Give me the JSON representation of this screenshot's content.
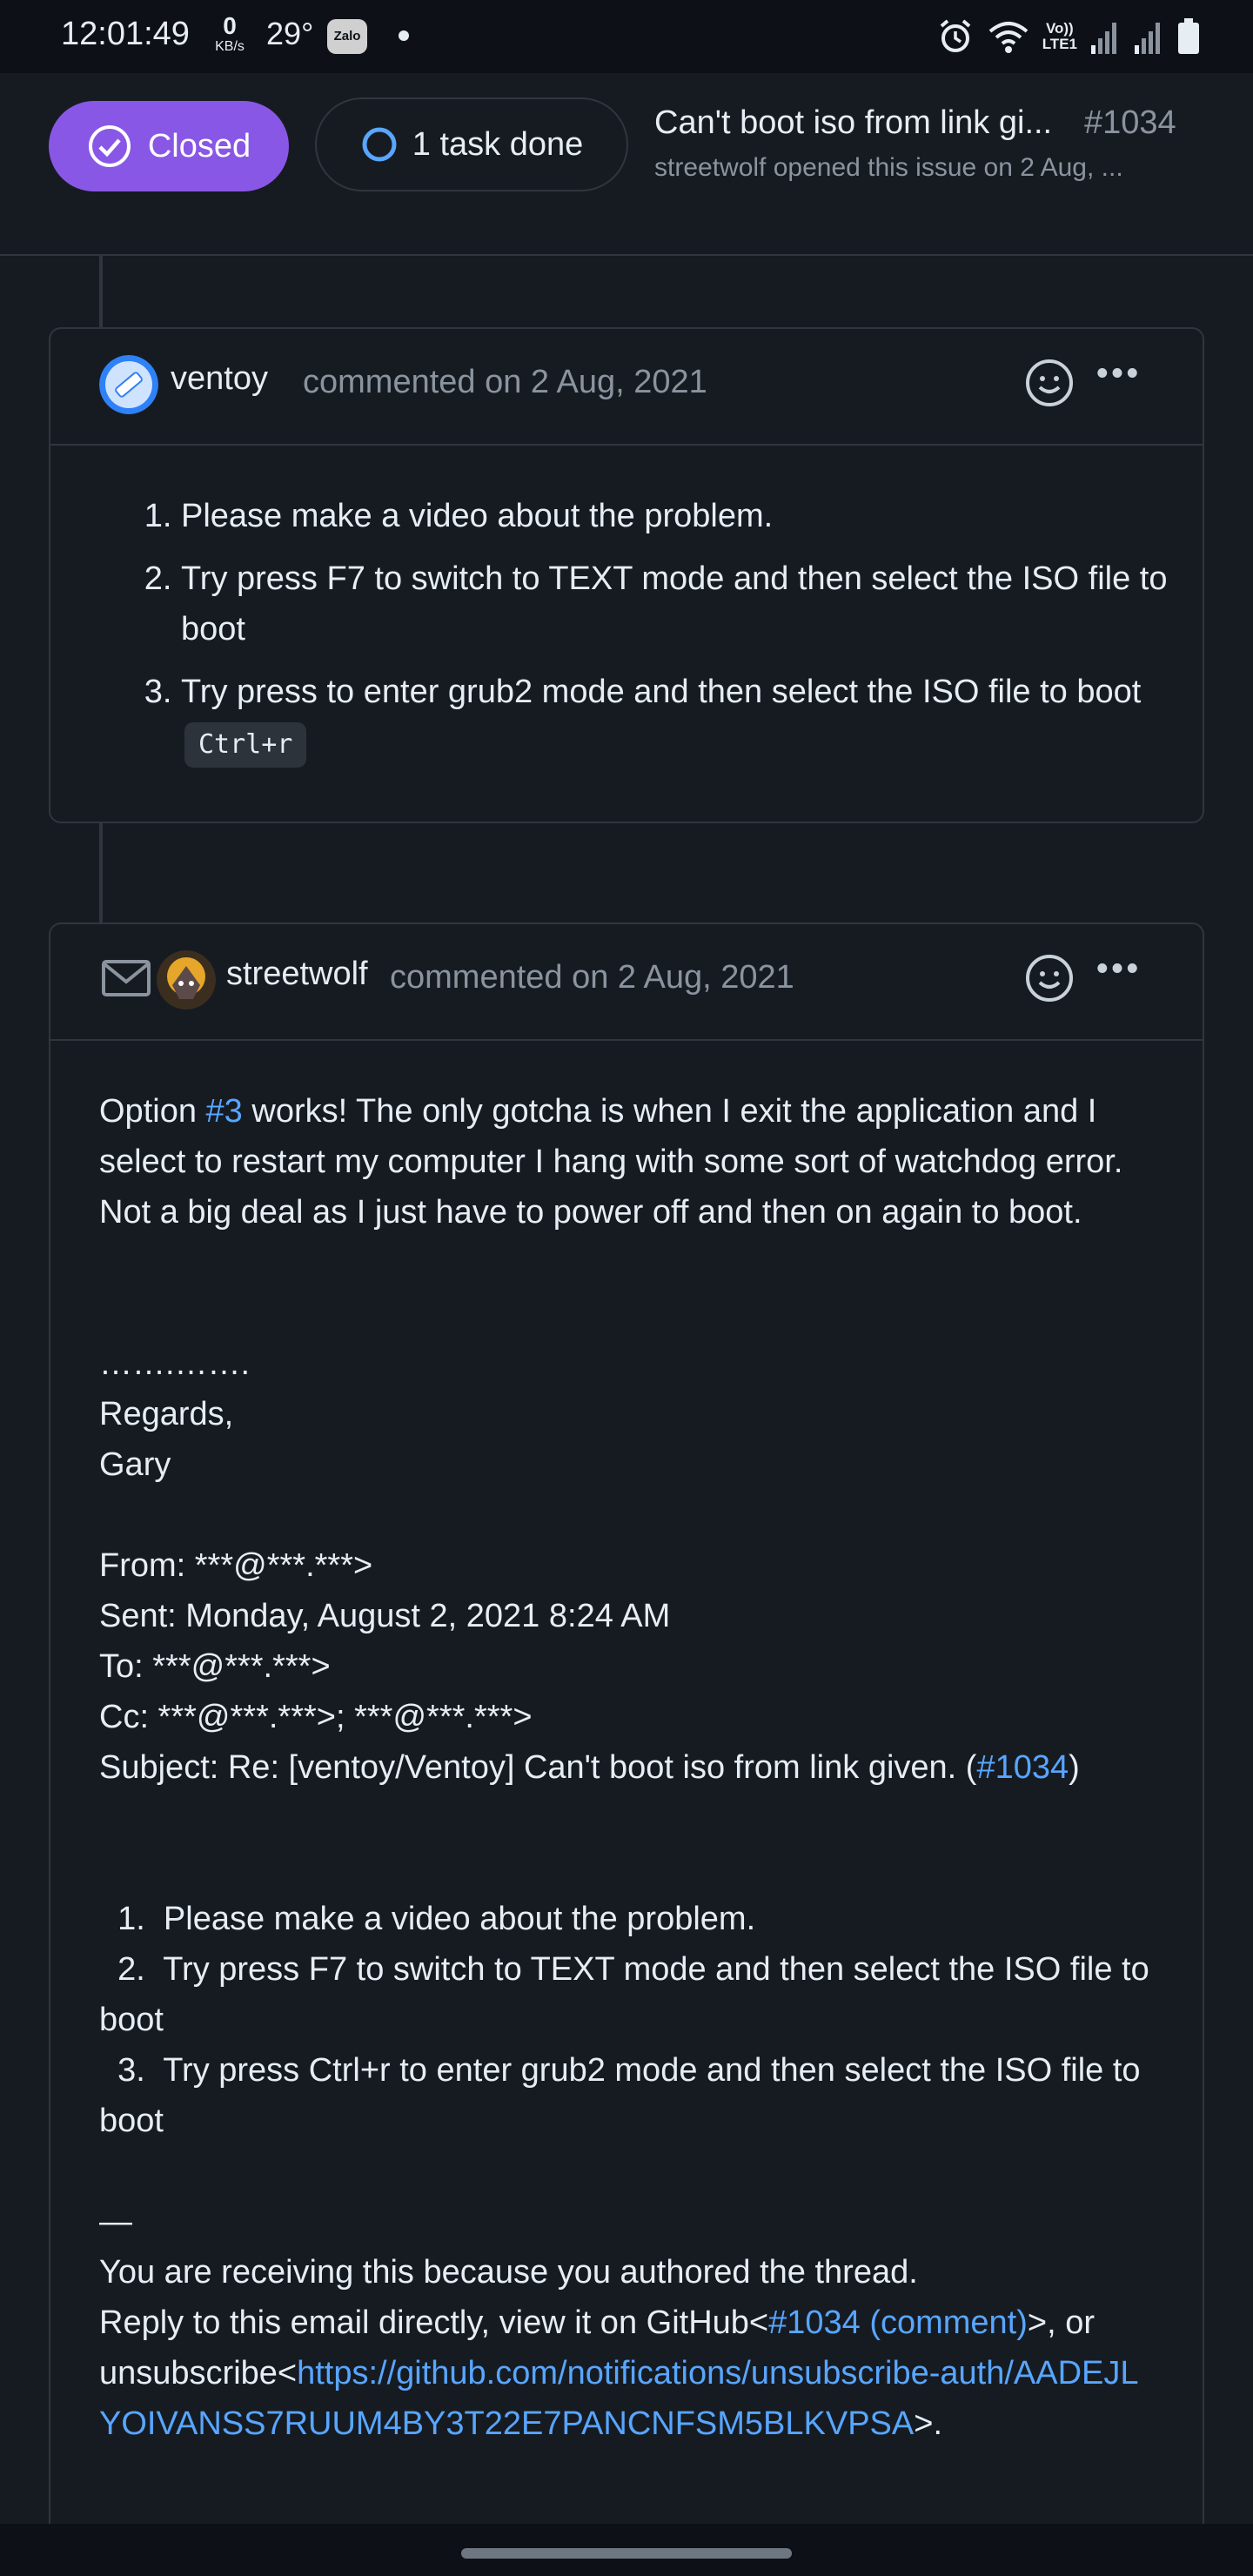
{
  "status_bar": {
    "time": "12:01:49",
    "net_speed": "0",
    "net_unit": "KB/s",
    "temperature": "29°",
    "zalo_label": "Zalo",
    "volte_top": "Vo))",
    "volte_bottom": "LTE1"
  },
  "issue_header": {
    "state_label": "Closed",
    "tasks_label": "1 task done",
    "title": "Can't boot iso from link gi...",
    "number": "#1034",
    "subtitle": "streetwolf opened this issue on 2 Aug, ..."
  },
  "comment1": {
    "author": "ventoy",
    "meta": "commented on 2 Aug, 2021",
    "items": [
      "Please make a video about the problem.",
      "Try press F7 to switch to TEXT mode and then select the ISO file to boot",
      "Try press to enter grub2 mode and then select the ISO file to boot"
    ],
    "kbd": "Ctrl+r"
  },
  "comment2": {
    "author": "streetwolf",
    "meta": "commented on 2 Aug, 2021",
    "p1_before": "Option ",
    "p1_link": "#3",
    "p1_after": " works!  The only gotcha is when I exit the application and I select to restart my computer I hang with some sort of watchdog error.  Not a big deal as I just have to power off and then on again to boot.",
    "dots": "…….…….",
    "regards": "Regards,",
    "name": "Gary",
    "from": "From: ***@***.***>",
    "sent": "Sent: Monday, August 2, 2021 8:24 AM",
    "to": "To: ***@***.***>",
    "cc": "Cc: ***@***.***>; ***@***.***>",
    "subject_before": "Subject: Re: [ventoy/Ventoy] Can't boot iso from link given. (",
    "subject_link": "#1034",
    "subject_after": ")",
    "q1": "  1.  Please make a video about the problem.",
    "q2": "  2.  Try press F7 to switch to TEXT mode and then select the ISO file to boot",
    "q3": "  3.  Try press Ctrl+r to enter grub2 mode and then select the ISO file to boot",
    "dash": "—",
    "receiving": "You are receiving this because you authored the thread.",
    "reply_before": "Reply to this email directly, view it on GitHub<",
    "reply_link": "#1034 (comment)",
    "reply_after": ">, or unsubscribe<",
    "unsub_link": "https://github.com/notifications/unsubscribe-auth/AADEJLYOIVANSS7RUUM4BY3T22E7PANCNFSM5BLKVPSA",
    "unsub_after": ">."
  }
}
